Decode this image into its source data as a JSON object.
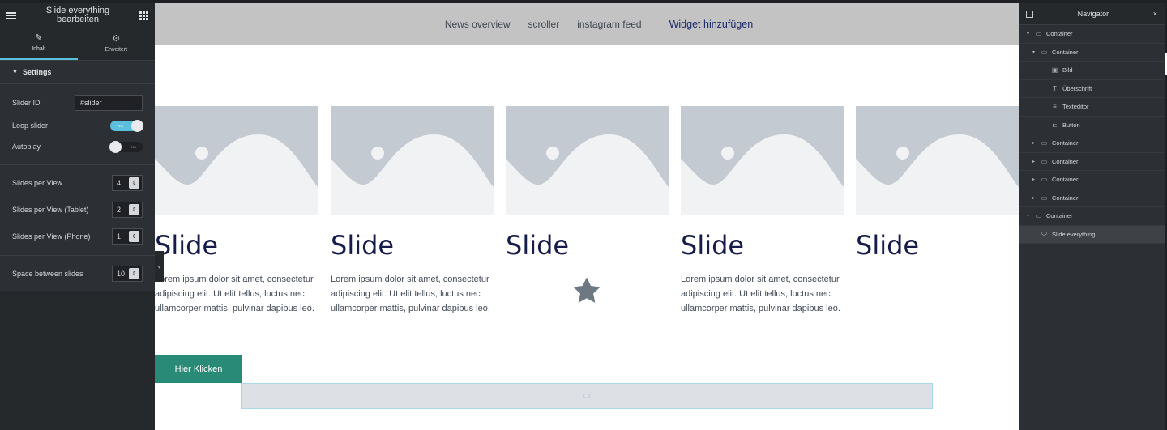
{
  "left_panel": {
    "title": "Slide everything bearbeiten",
    "tabs": [
      {
        "label": "Inhalt",
        "icon": "pencil-icon"
      },
      {
        "label": "Erweitert",
        "icon": "gear-icon"
      }
    ],
    "section_title": "Settings",
    "slider_id_label": "Slider ID",
    "slider_id_value": "#slider",
    "loop_label": "Loop slider",
    "loop_state": "YES",
    "autoplay_label": "Autoplay",
    "autoplay_state": "NO",
    "spv_label": "Slides per View",
    "spv_value": "4",
    "spv_tablet_label": "Slides per View (Tablet)",
    "spv_tablet_value": "2",
    "spv_phone_label": "Slides per View (Phone)",
    "spv_phone_value": "1",
    "space_label": "Space between slides",
    "space_value": "10"
  },
  "canvas": {
    "nav": [
      "News overview",
      "scroller",
      "instagram feed",
      "Widget hinzufügen"
    ],
    "slides": [
      {
        "title": "Slide",
        "text": "Lorem ipsum dolor sit amet, consectetur adipiscing elit. Ut elit tellus, luctus nec ullamcorper mattis, pulvinar dapibus leo."
      },
      {
        "title": "Slide",
        "text": "Lorem ipsum dolor sit amet, consectetur adipiscing elit. Ut elit tellus, luctus nec ullamcorper mattis, pulvinar dapibus leo."
      },
      {
        "title": "Slide",
        "text": ""
      },
      {
        "title": "Slide",
        "text": "Lorem ipsum dolor sit amet, consectetur adipiscing elit. Ut elit tellus, luctus nec ullamcorper mattis, pulvinar dapibus leo."
      },
      {
        "title": "Slide",
        "text": ""
      }
    ],
    "button_label": "Hier Klicken",
    "colors": {
      "accent": "#2a8a78",
      "title": "#161b4a",
      "placeholder": "#c4cad1"
    }
  },
  "navigator": {
    "title": "Navigator",
    "items": [
      {
        "label": "Container",
        "icon": "container-icon",
        "caret": "▾"
      },
      {
        "label": "Container",
        "icon": "container-icon",
        "caret": "▾"
      },
      {
        "label": "Bild",
        "icon": "image-icon",
        "caret": ""
      },
      {
        "label": "Überschrift",
        "icon": "heading-icon",
        "caret": ""
      },
      {
        "label": "Texteditor",
        "icon": "text-editor-icon",
        "caret": ""
      },
      {
        "label": "Button",
        "icon": "button-icon",
        "caret": ""
      },
      {
        "label": "Container",
        "icon": "container-icon",
        "caret": "▸"
      },
      {
        "label": "Container",
        "icon": "container-icon",
        "caret": "▸"
      },
      {
        "label": "Container",
        "icon": "container-icon",
        "caret": "▸"
      },
      {
        "label": "Container",
        "icon": "container-icon",
        "caret": "▸"
      },
      {
        "label": "Container",
        "icon": "container-icon",
        "caret": "▾"
      },
      {
        "label": "Slide everything",
        "icon": "slider-icon",
        "caret": ""
      }
    ]
  }
}
